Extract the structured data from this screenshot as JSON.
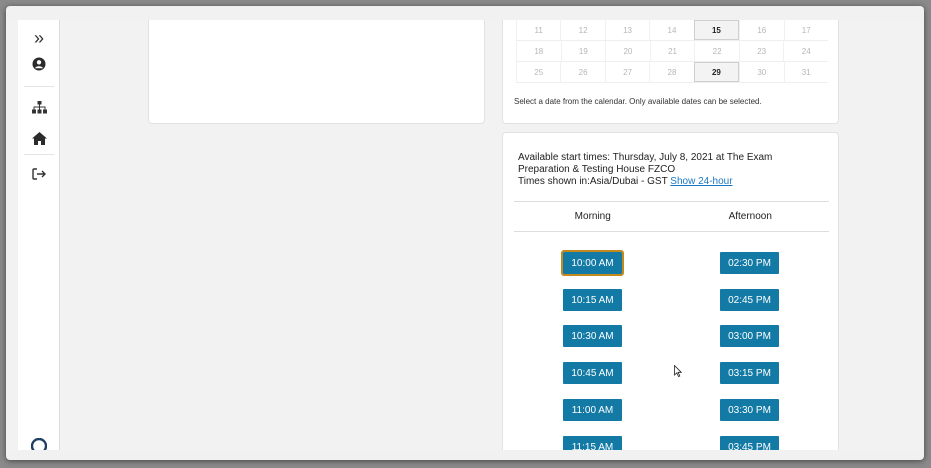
{
  "sidebar": {
    "items": [
      {
        "icon": "double-chevron-right-icon",
        "glyph": "»"
      },
      {
        "icon": "user-circle-icon",
        "glyph": "●"
      },
      {
        "icon": "sitemap-icon",
        "glyph": "⊞"
      },
      {
        "icon": "home-icon",
        "glyph": "⌂"
      },
      {
        "icon": "sign-out-icon",
        "glyph": "⇥"
      },
      {
        "icon": "help-icon",
        "glyph": "◉"
      }
    ]
  },
  "calendar": {
    "weeks": [
      [
        {
          "day": "11"
        },
        {
          "day": "12"
        },
        {
          "day": "13"
        },
        {
          "day": "14"
        },
        {
          "day": "15",
          "available": true
        },
        {
          "day": "16"
        },
        {
          "day": "17"
        }
      ],
      [
        {
          "day": "18"
        },
        {
          "day": "19"
        },
        {
          "day": "20"
        },
        {
          "day": "21"
        },
        {
          "day": "22"
        },
        {
          "day": "23"
        },
        {
          "day": "24"
        }
      ],
      [
        {
          "day": "25"
        },
        {
          "day": "26"
        },
        {
          "day": "27"
        },
        {
          "day": "28"
        },
        {
          "day": "29",
          "available": true
        },
        {
          "day": "30"
        },
        {
          "day": "31"
        }
      ]
    ],
    "note": "Select a date from the calendar. Only available dates can be selected."
  },
  "times": {
    "heading_line1": "Available start times: Thursday, July 8, 2021 at The Exam",
    "heading_line2": "Preparation & Testing House FZCO",
    "timezone_text": "Times shown in:Asia/Dubai - GST ",
    "toggle_link": "Show 24-hour",
    "morning_label": "Morning",
    "afternoon_label": "Afternoon",
    "morning": [
      "10:00 AM",
      "10:15 AM",
      "10:30 AM",
      "10:45 AM",
      "11:00 AM",
      "11:15 AM"
    ],
    "afternoon": [
      "02:30 PM",
      "02:45 PM",
      "03:00 PM",
      "03:15 PM",
      "03:30 PM",
      "03:45 PM"
    ],
    "focused_slot": "10:00 AM"
  },
  "colors": {
    "accent": "#137aa6",
    "focus_outline": "#c28a1e",
    "link": "#1a78c2"
  }
}
